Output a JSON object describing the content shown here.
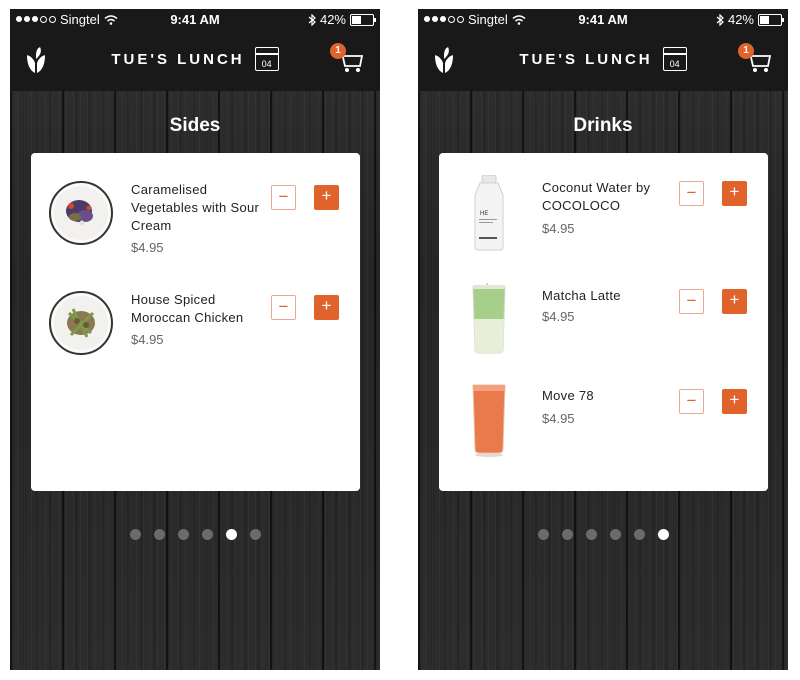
{
  "status": {
    "carrier": "Singtel",
    "time": "9:41 AM",
    "battery": "42%",
    "battery_level": 0.42
  },
  "header": {
    "title": "TUE'S LUNCH",
    "calendar_day": "04",
    "cart_count": "1",
    "logo_icon": "leaf-logo-icon",
    "cart_icon": "cart-icon"
  },
  "colors": {
    "accent": "#e0632c",
    "header_bg": "#191919",
    "card_bg": "#ffffff"
  },
  "screens": [
    {
      "heading": "Sides",
      "items": [
        {
          "name": "Caramelised Vegetables with Sour Cream",
          "price": "$4.95",
          "icon": "caramelised-vegetables-plate"
        },
        {
          "name": "House Spiced Moroccan Chicken",
          "price": "$4.95",
          "icon": "moroccan-chicken-plate"
        }
      ],
      "page_count": 6,
      "active_page": 5
    },
    {
      "heading": "Drinks",
      "items": [
        {
          "name": "Coconut Water by COCOLOCO",
          "price": "$4.95",
          "icon": "coconut-water-bottle"
        },
        {
          "name": "Matcha Latte",
          "price": "$4.95",
          "icon": "matcha-latte-glass"
        },
        {
          "name": "Move 78",
          "price": "$4.95",
          "icon": "juice-glass"
        }
      ],
      "page_count": 6,
      "active_page": 6
    }
  ],
  "buttons": {
    "minus": "−",
    "plus": "+"
  }
}
